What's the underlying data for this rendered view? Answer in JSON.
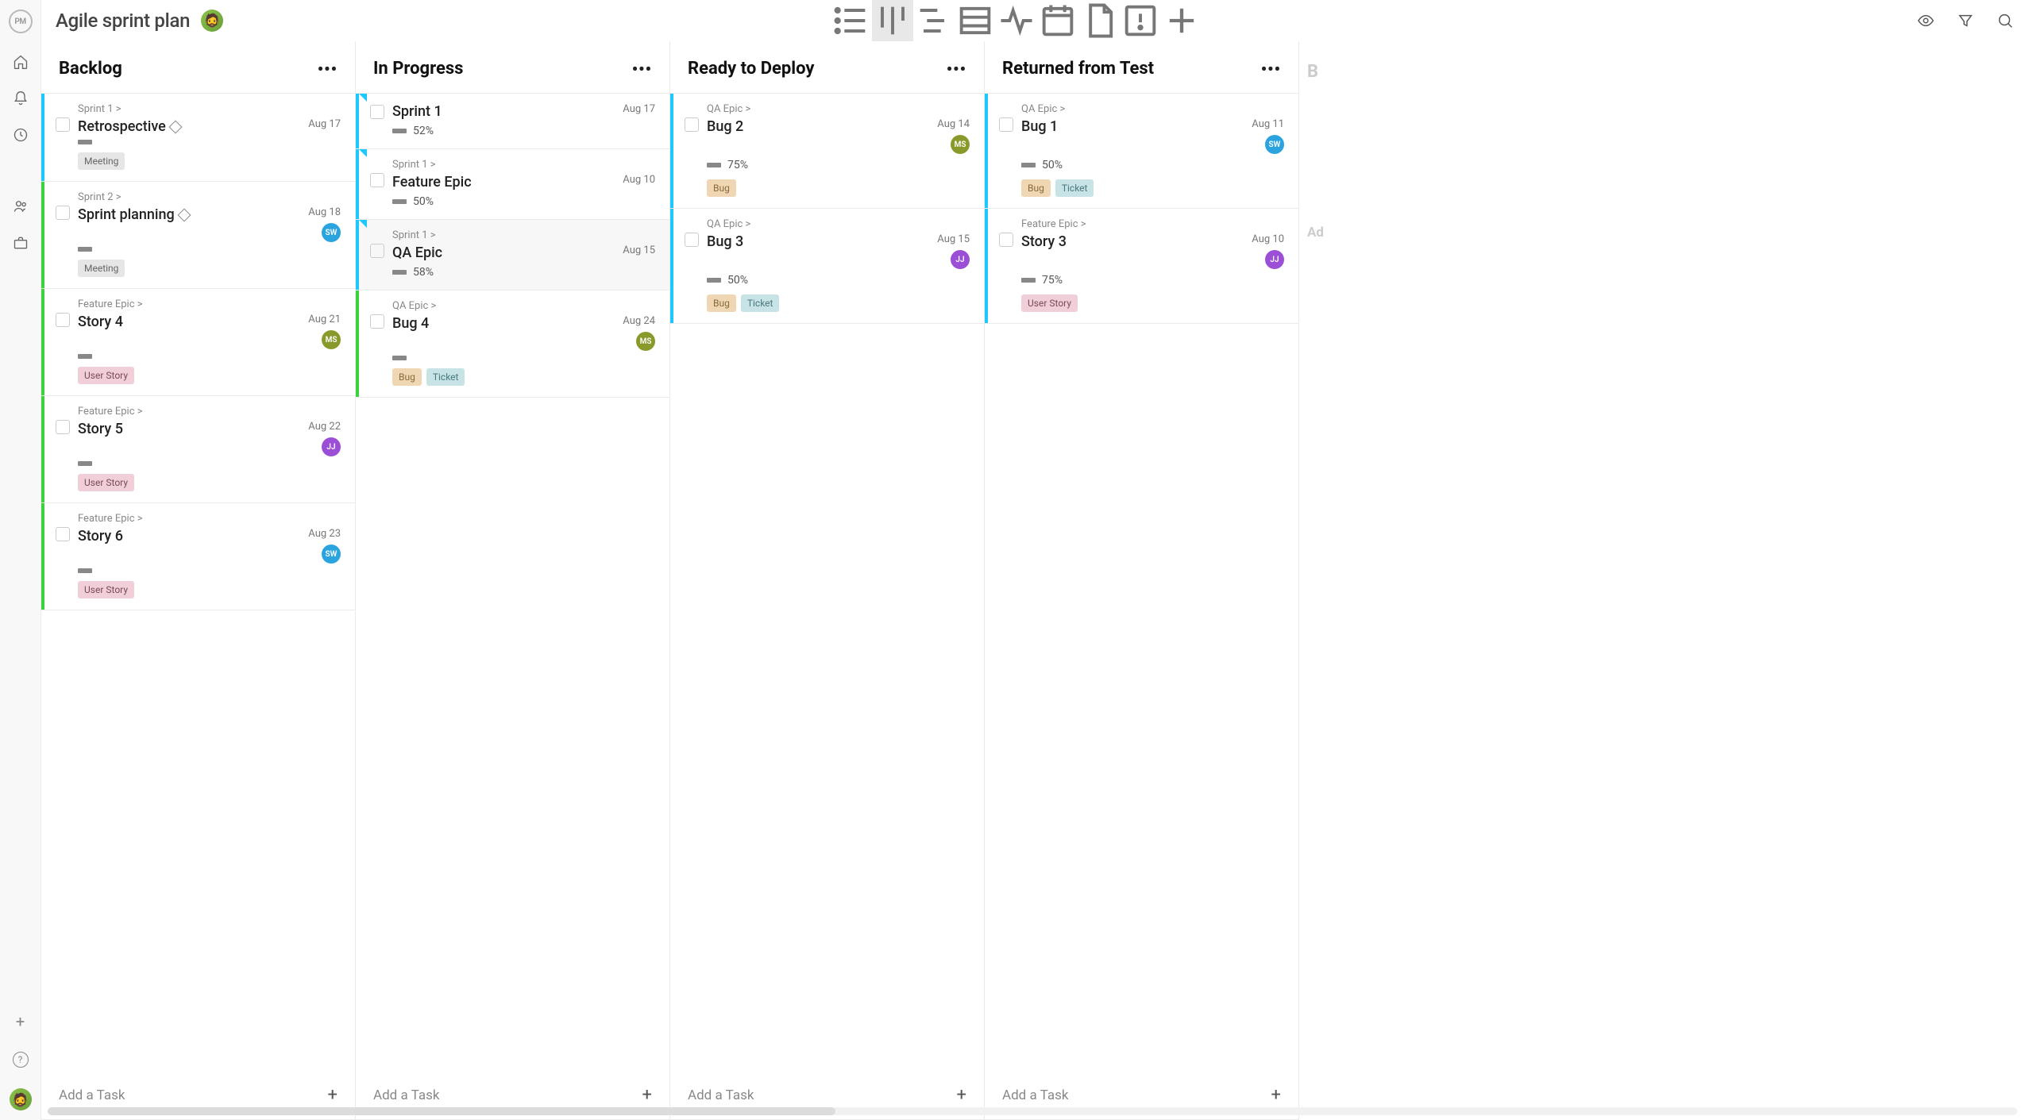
{
  "project": {
    "title": "Agile sprint plan"
  },
  "addTaskLabel": "Add a Task",
  "peekCol": {
    "initial": "B",
    "addPrefix": "Ad"
  },
  "columns": [
    {
      "title": "Backlog",
      "cards": [
        {
          "breadcrumb": "Sprint 1 >",
          "title": "Retrospective",
          "milestone": true,
          "date": "Aug 17",
          "percent": "",
          "tags": [
            {
              "type": "meeting",
              "label": "Meeting"
            }
          ],
          "assignee": null,
          "stripe": "#1fc7ff",
          "corner": null
        },
        {
          "breadcrumb": "Sprint 2 >",
          "title": "Sprint planning",
          "milestone": true,
          "date": "Aug 18",
          "percent": "",
          "tags": [
            {
              "type": "meeting",
              "label": "Meeting"
            }
          ],
          "assignee": {
            "initials": "SW",
            "cls": "av-sw"
          },
          "stripe": "#3dd23d",
          "corner": null
        },
        {
          "breadcrumb": "Feature Epic >",
          "title": "Story 4",
          "milestone": false,
          "date": "Aug 21",
          "percent": "",
          "tags": [
            {
              "type": "userstory",
              "label": "User Story"
            }
          ],
          "assignee": {
            "initials": "MS",
            "cls": "av-ms"
          },
          "stripe": "#3dd23d",
          "corner": null
        },
        {
          "breadcrumb": "Feature Epic >",
          "title": "Story 5",
          "milestone": false,
          "date": "Aug 22",
          "percent": "",
          "tags": [
            {
              "type": "userstory",
              "label": "User Story"
            }
          ],
          "assignee": {
            "initials": "JJ",
            "cls": "av-jj"
          },
          "stripe": "#3dd23d",
          "corner": null
        },
        {
          "breadcrumb": "Feature Epic >",
          "title": "Story 6",
          "milestone": false,
          "date": "Aug 23",
          "percent": "",
          "tags": [
            {
              "type": "userstory",
              "label": "User Story"
            }
          ],
          "assignee": {
            "initials": "SW",
            "cls": "av-sw"
          },
          "stripe": "#3dd23d",
          "corner": null
        }
      ]
    },
    {
      "title": "In Progress",
      "cards": [
        {
          "breadcrumb": "",
          "title": "Sprint 1",
          "milestone": false,
          "date": "Aug 17",
          "percent": "52%",
          "tags": [],
          "assignee": null,
          "stripe": "#1fc7ff",
          "corner": "#1fc7ff"
        },
        {
          "breadcrumb": "Sprint 1 >",
          "title": "Feature Epic",
          "milestone": false,
          "date": "Aug 10",
          "percent": "50%",
          "tags": [],
          "assignee": null,
          "stripe": "#1fc7ff",
          "corner": "#1fc7ff"
        },
        {
          "breadcrumb": "Sprint 1 >",
          "title": "QA Epic",
          "milestone": false,
          "date": "Aug 15",
          "percent": "58%",
          "tags": [],
          "assignee": null,
          "stripe": "#1fc7ff",
          "corner": "#1fc7ff",
          "highlighted": true
        },
        {
          "breadcrumb": "QA Epic >",
          "title": "Bug 4",
          "milestone": false,
          "date": "Aug 24",
          "percent": "",
          "tags": [
            {
              "type": "bug",
              "label": "Bug"
            },
            {
              "type": "ticket",
              "label": "Ticket"
            }
          ],
          "assignee": {
            "initials": "MS",
            "cls": "av-ms"
          },
          "stripe": "#3dd23d",
          "corner": null
        }
      ]
    },
    {
      "title": "Ready to Deploy",
      "cards": [
        {
          "breadcrumb": "QA Epic >",
          "title": "Bug 2",
          "milestone": false,
          "date": "Aug 14",
          "percent": "75%",
          "tags": [
            {
              "type": "bug",
              "label": "Bug"
            }
          ],
          "assignee": {
            "initials": "MS",
            "cls": "av-ms"
          },
          "stripe": "#1fc7ff",
          "corner": null
        },
        {
          "breadcrumb": "QA Epic >",
          "title": "Bug 3",
          "milestone": false,
          "date": "Aug 15",
          "percent": "50%",
          "tags": [
            {
              "type": "bug",
              "label": "Bug"
            },
            {
              "type": "ticket",
              "label": "Ticket"
            }
          ],
          "assignee": {
            "initials": "JJ",
            "cls": "av-jj"
          },
          "stripe": "#1fc7ff",
          "corner": null
        }
      ]
    },
    {
      "title": "Returned from Test",
      "cards": [
        {
          "breadcrumb": "QA Epic >",
          "title": "Bug 1",
          "milestone": false,
          "date": "Aug 11",
          "percent": "50%",
          "tags": [
            {
              "type": "bug",
              "label": "Bug"
            },
            {
              "type": "ticket",
              "label": "Ticket"
            }
          ],
          "assignee": {
            "initials": "SW",
            "cls": "av-sw"
          },
          "stripe": "#1fc7ff",
          "corner": null
        },
        {
          "breadcrumb": "Feature Epic >",
          "title": "Story 3",
          "milestone": false,
          "date": "Aug 10",
          "percent": "75%",
          "tags": [
            {
              "type": "userstory",
              "label": "User Story"
            }
          ],
          "assignee": {
            "initials": "JJ",
            "cls": "av-jj"
          },
          "stripe": "#1fc7ff",
          "corner": null
        }
      ]
    }
  ]
}
